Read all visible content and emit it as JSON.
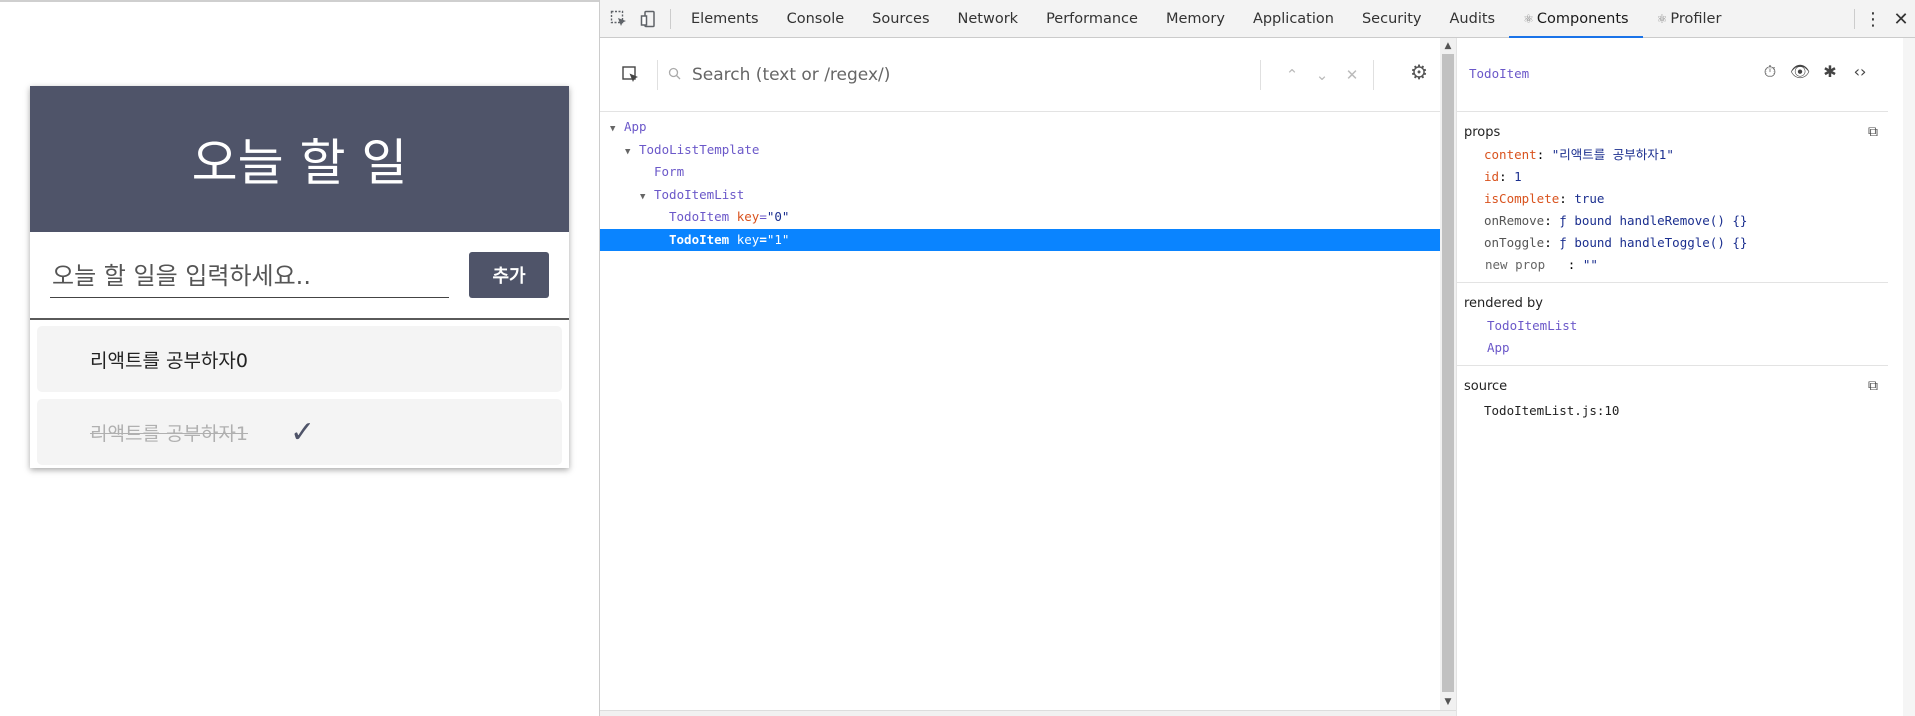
{
  "app": {
    "title": "오늘 할 일",
    "input_placeholder": "오늘 할 일을 입력하세요..",
    "add_label": "추가",
    "todos": [
      {
        "text": "리액트를 공부하자0",
        "complete": false,
        "check": ""
      },
      {
        "text": "리액트를 공부하자1",
        "complete": true,
        "check": "✓"
      }
    ]
  },
  "devtools": {
    "tabs": [
      {
        "label": "Elements",
        "glyph": ""
      },
      {
        "label": "Console",
        "glyph": ""
      },
      {
        "label": "Sources",
        "glyph": ""
      },
      {
        "label": "Network",
        "glyph": ""
      },
      {
        "label": "Performance",
        "glyph": ""
      },
      {
        "label": "Memory",
        "glyph": ""
      },
      {
        "label": "Application",
        "glyph": ""
      },
      {
        "label": "Security",
        "glyph": ""
      },
      {
        "label": "Audits",
        "glyph": ""
      },
      {
        "label": "Components",
        "glyph": "⚛",
        "active": true
      },
      {
        "label": "Profiler",
        "glyph": "⚛"
      }
    ],
    "search_placeholder": "Search (text or /regex/)",
    "tree": [
      {
        "name": "App",
        "expanded": true,
        "key": null
      },
      {
        "name": "TodoListTemplate",
        "expanded": true,
        "key": null
      },
      {
        "name": "Form",
        "expanded": false,
        "key": null
      },
      {
        "name": "TodoItemList",
        "expanded": true,
        "key": null
      },
      {
        "name": "TodoItem",
        "expanded": false,
        "key": "\"0\""
      },
      {
        "name": "TodoItem",
        "expanded": false,
        "key": "\"1\"",
        "selected": true
      }
    ],
    "selected_component": "TodoItem",
    "props_title": "props",
    "props": [
      {
        "key": "content",
        "value": "\"리액트를 공부하자1\"",
        "kind": "str"
      },
      {
        "key": "id",
        "value": "1",
        "kind": "num"
      },
      {
        "key": "isComplete",
        "value": "true",
        "kind": "bool"
      },
      {
        "key": "onRemove",
        "value": "ƒ bound handleRemove() {}",
        "kind": "fn"
      },
      {
        "key": "onToggle",
        "value": "ƒ bound handleToggle() {}",
        "kind": "fn"
      },
      {
        "key": "new prop",
        "value": "\"\"",
        "kind": "new"
      }
    ],
    "rendered_by_title": "rendered by",
    "rendered_by": [
      "TodoItemList",
      "App"
    ],
    "source_title": "source",
    "source": "TodoItemList.js:10"
  }
}
